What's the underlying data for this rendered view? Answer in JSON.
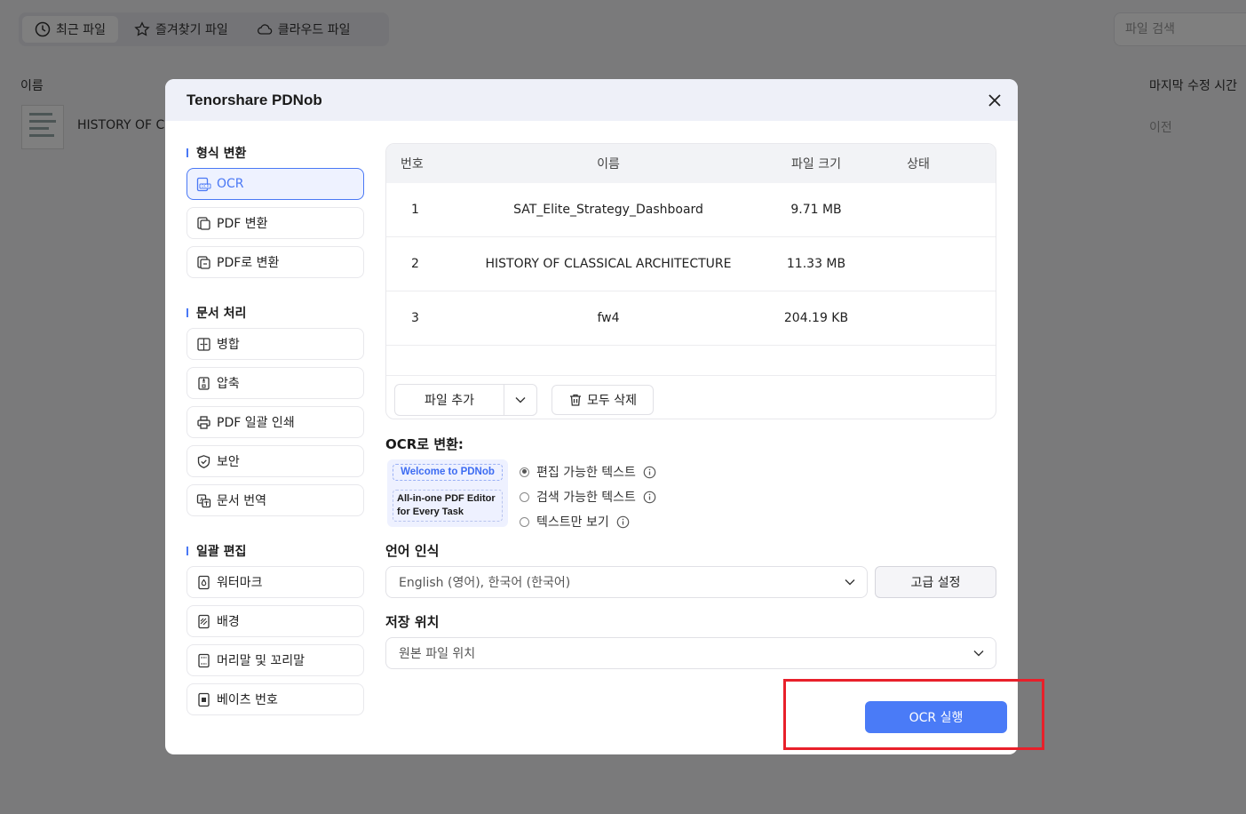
{
  "background": {
    "tabs": [
      {
        "label": "최근 파일",
        "icon": "clock-icon"
      },
      {
        "label": "즐겨찾기 파일",
        "icon": "star-icon"
      },
      {
        "label": "클라우드 파일",
        "icon": "cloud-icon"
      }
    ],
    "search_placeholder": "파일 검색",
    "col_name": "이름",
    "col_time": "마지막 수정 시간",
    "row_name": "HISTORY OF CL",
    "row_time": "이전"
  },
  "modal": {
    "title": "Tenorshare PDNob",
    "sections": [
      {
        "title": "형식 변환",
        "items": [
          "OCR",
          "PDF 변환",
          "PDF로 변환"
        ]
      },
      {
        "title": "문서 처리",
        "items": [
          "병합",
          "압축",
          "PDF 일괄 인쇄",
          "보안",
          "문서 번역"
        ]
      },
      {
        "title": "일괄 편집",
        "items": [
          "워터마크",
          "배경",
          "머리말 및 꼬리말",
          "베이츠 번호"
        ]
      }
    ],
    "table": {
      "headers": {
        "no": "번호",
        "name": "이름",
        "size": "파일 크기",
        "state": "상태"
      },
      "rows": [
        {
          "no": "1",
          "name": "SAT_Elite_Strategy_Dashboard",
          "size": "9.71 MB",
          "state": ""
        },
        {
          "no": "2",
          "name": "HISTORY OF CLASSICAL ARCHITECTURE",
          "size": "11.33 MB",
          "state": ""
        },
        {
          "no": "3",
          "name": "fw4",
          "size": "204.19 KB",
          "state": ""
        }
      ]
    },
    "add_file_label": "파일 추가",
    "delete_all_label": "모두 삭제",
    "ocr_label": "OCR로 변환:",
    "thumb_line1": "Welcome to PDNob",
    "thumb_line2": "All-in-one PDF Editor for Every Task",
    "radio_options": [
      {
        "label": "편집 가능한 텍스트",
        "checked": true
      },
      {
        "label": "검색 가능한 텍스트",
        "checked": false
      },
      {
        "label": "텍스트만 보기",
        "checked": false
      }
    ],
    "lang_label": "언어 인식",
    "lang_value": "English (영어), 한국어 (한국어)",
    "advanced_label": "고급 설정",
    "save_label": "저장 위치",
    "save_value": "원본 파일 위치",
    "run_label": "OCR 실행"
  },
  "colors": {
    "accent": "#4a7bf7",
    "highlight": "#e8202a"
  }
}
